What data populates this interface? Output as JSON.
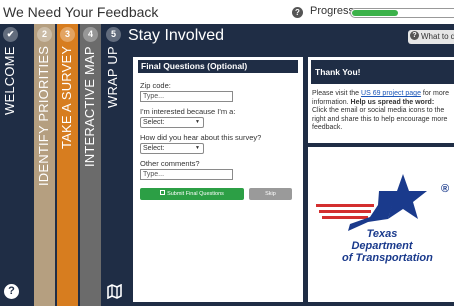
{
  "header": {
    "app_title": "We Need Your Feedback",
    "help_icon": "?",
    "progress_label": "Progress",
    "progress_value": 0.45
  },
  "tabs": [
    {
      "num": "✔",
      "label": "WELCOME",
      "color": "#1f2d45"
    },
    {
      "num": "2",
      "label": "IDENTIFY PRIORITIES",
      "color": "#b59f80"
    },
    {
      "num": "3",
      "label": "TAKE A SURVEY",
      "color": "#d77d1f"
    },
    {
      "num": "4",
      "label": "INTERACTIVE MAP",
      "color": "#6b6b6b"
    },
    {
      "num": "5",
      "label": "WRAP UP",
      "color": "#1f2d45"
    }
  ],
  "content": {
    "title": "Stay Involved",
    "what_to_do": "What to d"
  },
  "form": {
    "header": "Final Questions (Optional)",
    "zip_label": "Zip code:",
    "zip_placeholder": "Type...",
    "interest_label": "I'm interested because I'm a:",
    "interest_selected": "Select:",
    "hear_label": "How did you hear about this survey?",
    "hear_selected": "Select:",
    "comments_label": "Other comments?",
    "comments_placeholder": "Type...",
    "submit_label": "Submit Final Questions",
    "skip_label": "Skip"
  },
  "thanks": {
    "header": "Thank You!",
    "text_1": "Please visit the ",
    "link": "US 69 project page",
    "text_2": " for more information. ",
    "bold_1": "Help us spread the word:",
    "text_3": " Click the email or social media icons to the right and share this to help encourage more feedback."
  },
  "logo": {
    "line1": "Texas",
    "line2": "Department",
    "line3": "of Transportation",
    "reg": "®",
    "blue": "#1a3a8c",
    "red": "#d32f2f"
  }
}
